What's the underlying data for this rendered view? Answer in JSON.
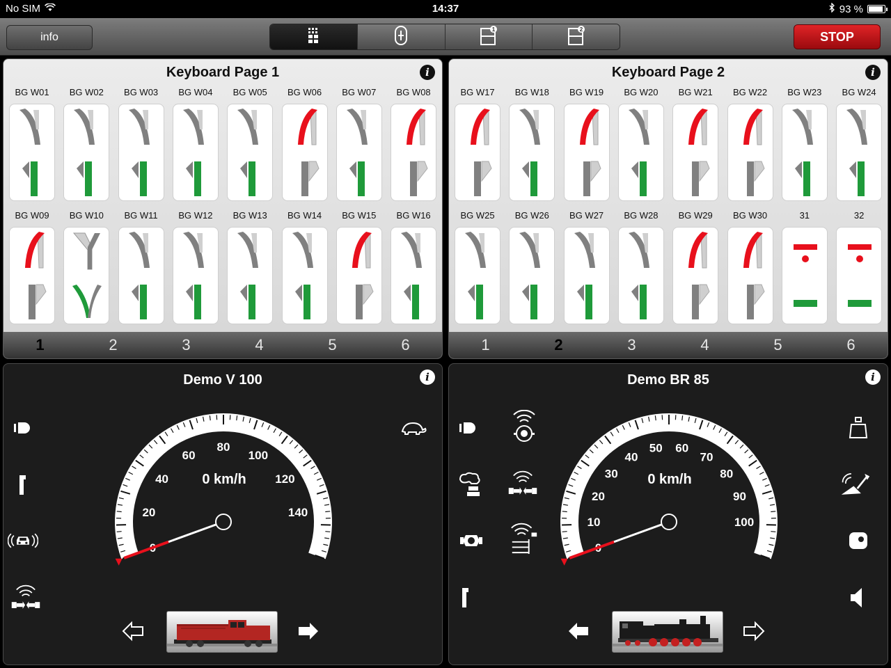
{
  "status_bar": {
    "carrier": "No SIM",
    "time": "14:37",
    "battery_text": "93 %",
    "battery_level": 0.93
  },
  "toolbar": {
    "info_label": "info",
    "segments": [
      {
        "icon": "keyboard-grid-icon",
        "active": true
      },
      {
        "icon": "controller-icon",
        "active": false
      },
      {
        "icon": "layout-1-icon",
        "active": false
      },
      {
        "icon": "layout-2-icon",
        "active": false
      }
    ],
    "stop_label": "STOP"
  },
  "keyboards": [
    {
      "title": "Keyboard Page 1",
      "pages": [
        "1",
        "2",
        "3",
        "4",
        "5",
        "6"
      ],
      "active_page": 0,
      "tiles": [
        {
          "label": "BG W01",
          "type": "turnout",
          "state": "straight"
        },
        {
          "label": "BG W02",
          "type": "turnout",
          "state": "straight"
        },
        {
          "label": "BG W03",
          "type": "turnout",
          "state": "straight"
        },
        {
          "label": "BG W04",
          "type": "turnout",
          "state": "straight"
        },
        {
          "label": "BG W05",
          "type": "turnout",
          "state": "straight"
        },
        {
          "label": "BG W06",
          "type": "turnout",
          "state": "diverging"
        },
        {
          "label": "BG W07",
          "type": "turnout",
          "state": "straight"
        },
        {
          "label": "BG W08",
          "type": "turnout",
          "state": "diverging"
        },
        {
          "label": "BG W09",
          "type": "turnout",
          "state": "diverging"
        },
        {
          "label": "BG W10",
          "type": "wye",
          "state": "straight"
        },
        {
          "label": "BG W11",
          "type": "turnout",
          "state": "straight"
        },
        {
          "label": "BG W12",
          "type": "turnout",
          "state": "straight"
        },
        {
          "label": "BG W13",
          "type": "turnout",
          "state": "straight"
        },
        {
          "label": "BG W14",
          "type": "turnout",
          "state": "straight"
        },
        {
          "label": "BG W15",
          "type": "turnout",
          "state": "diverging"
        },
        {
          "label": "BG W16",
          "type": "turnout",
          "state": "straight"
        }
      ]
    },
    {
      "title": "Keyboard Page 2",
      "pages": [
        "1",
        "2",
        "3",
        "4",
        "5",
        "6"
      ],
      "active_page": 1,
      "tiles": [
        {
          "label": "BG W17",
          "type": "turnout",
          "state": "diverging"
        },
        {
          "label": "BG W18",
          "type": "turnout",
          "state": "straight"
        },
        {
          "label": "BG W19",
          "type": "turnout",
          "state": "diverging"
        },
        {
          "label": "BG W20",
          "type": "turnout",
          "state": "straight"
        },
        {
          "label": "BG W21",
          "type": "turnout",
          "state": "diverging"
        },
        {
          "label": "BG W22",
          "type": "turnout",
          "state": "diverging"
        },
        {
          "label": "BG W23",
          "type": "turnout",
          "state": "straight"
        },
        {
          "label": "BG W24",
          "type": "turnout",
          "state": "straight"
        },
        {
          "label": "BG W25",
          "type": "turnout",
          "state": "straight"
        },
        {
          "label": "BG W26",
          "type": "turnout",
          "state": "straight"
        },
        {
          "label": "BG W27",
          "type": "turnout",
          "state": "straight"
        },
        {
          "label": "BG W28",
          "type": "turnout",
          "state": "straight"
        },
        {
          "label": "BG W29",
          "type": "turnout",
          "state": "diverging"
        },
        {
          "label": "BG W30",
          "type": "turnout",
          "state": "diverging"
        },
        {
          "label": "31",
          "type": "signal",
          "state": "green"
        },
        {
          "label": "32",
          "type": "signal",
          "state": "green"
        }
      ]
    }
  ],
  "locos": [
    {
      "name": "Demo V 100",
      "speed_text": "0 km/h",
      "speed": 0,
      "max_speed": 160,
      "tick_labels": [
        "0",
        "20",
        "40",
        "60",
        "80",
        "100",
        "120",
        "140"
      ],
      "tick_values": [
        0,
        20,
        40,
        60,
        80,
        100,
        120,
        140
      ],
      "direction": "forward",
      "left_functions": [
        "headlight-icon",
        "cab-light-icon",
        "horn-icon",
        "coupler-sound-icon"
      ],
      "right_functions": [
        "turtle-shunting-icon"
      ],
      "image_colors": {
        "body": "#b32622",
        "roof": "#8f1b18",
        "chassis": "#222222"
      }
    },
    {
      "name": "Demo BR 85",
      "speed_text": "0 km/h",
      "speed": 0,
      "max_speed": 110,
      "tick_labels": [
        "0",
        "10",
        "20",
        "30",
        "40",
        "50",
        "60",
        "70",
        "80",
        "90",
        "100"
      ],
      "tick_values": [
        0,
        10,
        20,
        30,
        40,
        50,
        60,
        70,
        80,
        90,
        100
      ],
      "direction": "reverse",
      "left_functions": [
        "headlight-icon",
        "smoke-generator-icon",
        "coupler-icon",
        "cab-light-icon"
      ],
      "middle_functions": [
        "wheel-sound-icon",
        "coupling-sound-icon",
        "shoveling-sound-icon"
      ],
      "right_functions": [
        "weight-icon",
        "coal-shovel-icon",
        "bell-icon",
        "sound-volume-icon"
      ],
      "image_colors": {
        "body": "#1a1a1a",
        "wheels": "#c42020",
        "chassis": "#333333"
      }
    }
  ],
  "colors": {
    "red": "#e8101c",
    "green": "#1f9a3a",
    "gray": "#808080",
    "stop": "#c5161a"
  }
}
